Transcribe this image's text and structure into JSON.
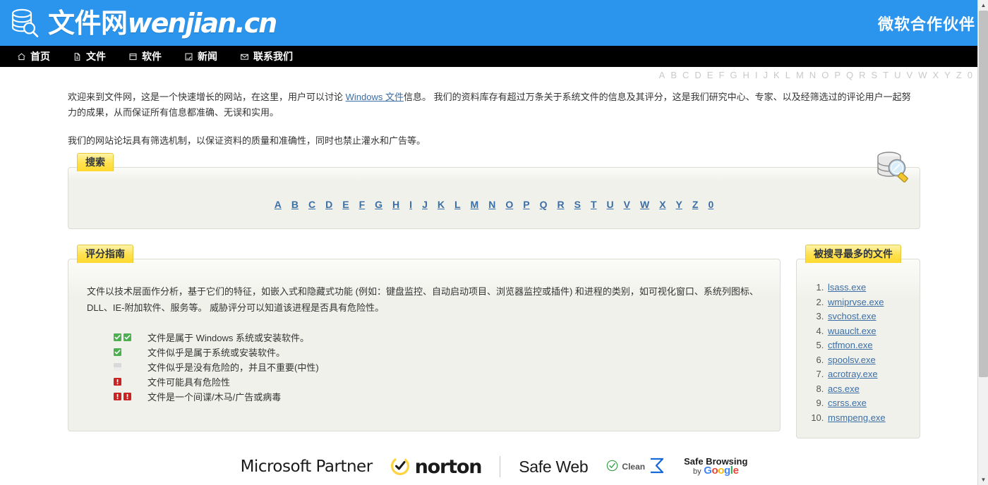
{
  "header": {
    "brand_cn": "文件网",
    "brand_latin": "wenjian.cn",
    "partner_badge": "微软合作伙伴",
    "logo_icon": "database-search-icon",
    "bg_color": "#2b95ed"
  },
  "nav": {
    "items": [
      {
        "label": "首页",
        "icon": "home-icon"
      },
      {
        "label": "文件",
        "icon": "document-icon"
      },
      {
        "label": "软件",
        "icon": "window-icon"
      },
      {
        "label": "新闻",
        "icon": "rss-icon"
      },
      {
        "label": "联系我们",
        "icon": "envelope-icon"
      }
    ]
  },
  "top_alphabet": [
    "A",
    "B",
    "C",
    "D",
    "E",
    "F",
    "G",
    "H",
    "I",
    "J",
    "K",
    "L",
    "M",
    "N",
    "O",
    "P",
    "Q",
    "R",
    "S",
    "T",
    "U",
    "V",
    "W",
    "X",
    "Y",
    "Z",
    "0"
  ],
  "intro": {
    "p1_before_link": "欢迎来到文件网，这是一个快速增长的网站，在这里，用户可以讨论 ",
    "p1_link": "Windows 文件",
    "p1_after_link": "信息。 我们的资料库存有超过万条关于系统文件的信息及其评分，这是我们研究中心、专家、以及经筛选过的评论用户一起努力的成果，从而保证所有信息都准确、无误和实用。",
    "p2": "我们的网站论坛具有筛选机制，以保证资料的质量和准确性，同时也禁止灌水和广告等。"
  },
  "search_panel": {
    "tab_label": "搜索",
    "badge_icon": "database-magnifier-icon",
    "letters": [
      "A",
      "B",
      "C",
      "D",
      "E",
      "F",
      "G",
      "H",
      "I",
      "J",
      "K",
      "L",
      "M",
      "N",
      "O",
      "P",
      "Q",
      "R",
      "S",
      "T",
      "U",
      "V",
      "W",
      "X",
      "Y",
      "Z",
      "0"
    ]
  },
  "guide_panel": {
    "tab_label": "评分指南",
    "description": "文件以技术层面作分析，基于它们的特征，如嵌入式和隐藏式功能 (例如：键盘监控、自动启动项目、浏览器监控或插件) 和进程的类别，如可视化窗口、系统列图标、DLL、IE-附加软件、服务等。 威胁评分可以知道该进程是否具有危险性。",
    "legend": [
      {
        "icons": [
          "check-green",
          "check-green"
        ],
        "label": "文件是属于 Windows 系统或安装软件。"
      },
      {
        "icons": [
          "check-green"
        ],
        "label": "文件似乎是属于系统或安装软件。"
      },
      {
        "icons": [
          "neutral-gray"
        ],
        "label": "文件似乎是没有危险的，并且不重要(中性)"
      },
      {
        "icons": [
          "warn-red"
        ],
        "label": "文件可能具有危险性"
      },
      {
        "icons": [
          "warn-red",
          "warn-red"
        ],
        "label": "文件是一个间谍/木马/广告或病毒"
      }
    ],
    "colors": {
      "check": "#4caf50",
      "neutral": "#d9d9d9",
      "warn": "#cc2222"
    }
  },
  "most_searched": {
    "tab_label": "被搜寻最多的文件",
    "files": [
      "lsass.exe",
      "wmiprvse.exe",
      "svchost.exe",
      "wuauclt.exe",
      "ctfmon.exe",
      "spoolsv.exe",
      "acrotray.exe",
      "acs.exe",
      "csrss.exe",
      "msmpeng.exe"
    ]
  },
  "footer": {
    "microsoft_partner": "Microsoft Partner",
    "norton": "norton",
    "safe_web": "Safe Web",
    "clean": "Clean",
    "safe_browsing_title": "Safe Browsing",
    "safe_browsing_by": "by",
    "google_letters": [
      "G",
      "o",
      "o",
      "g",
      "l",
      "e"
    ]
  }
}
